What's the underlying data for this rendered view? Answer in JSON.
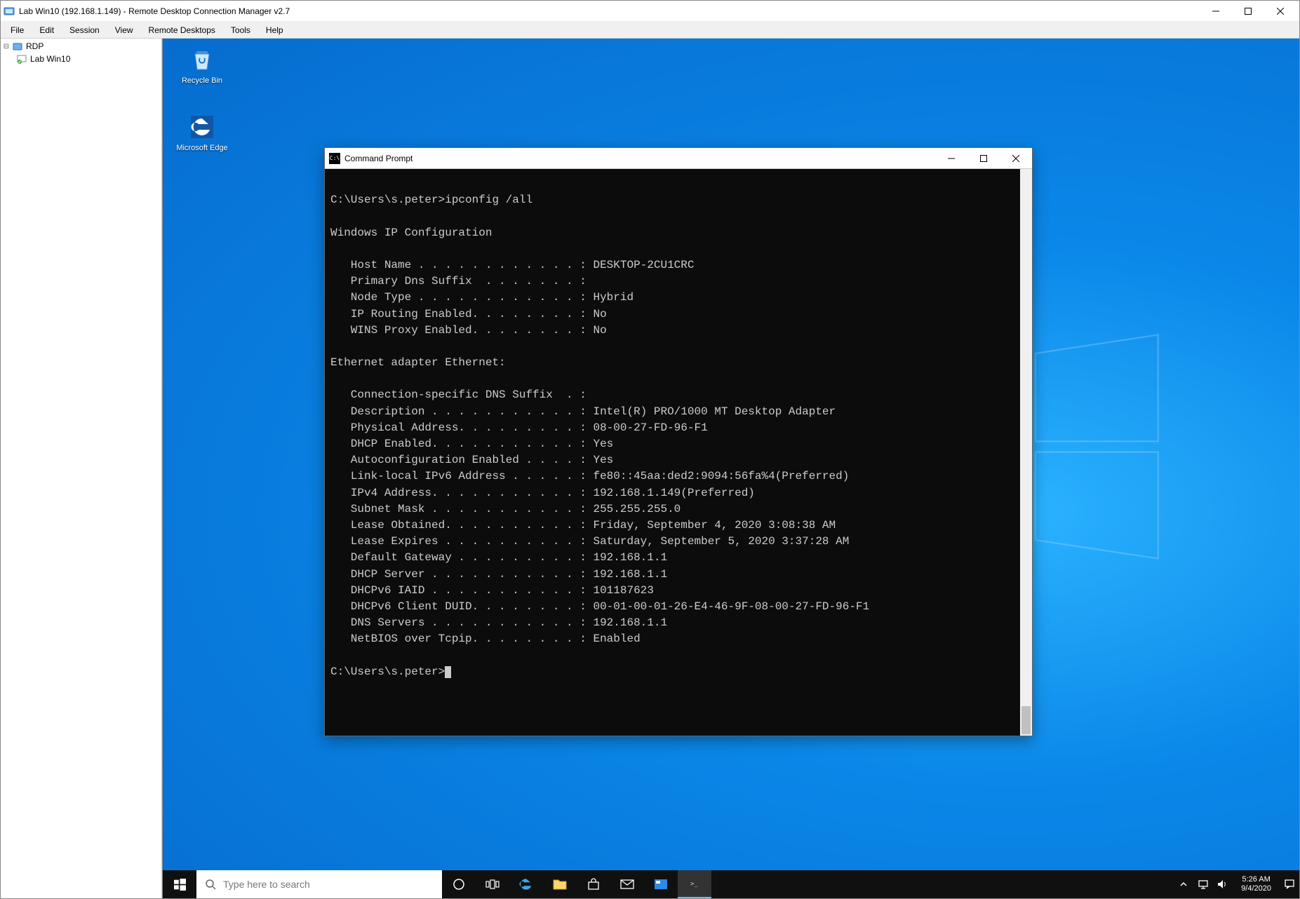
{
  "app": {
    "title": "Lab Win10 (192.168.1.149) - Remote Desktop Connection Manager v2.7",
    "menu": [
      "File",
      "Edit",
      "Session",
      "View",
      "Remote Desktops",
      "Tools",
      "Help"
    ]
  },
  "tree": {
    "root": "RDP",
    "child": "Lab Win10"
  },
  "desktop": {
    "icons": [
      {
        "name": "recycle-bin",
        "label": "Recycle Bin"
      },
      {
        "name": "edge",
        "label": "Microsoft Edge"
      }
    ]
  },
  "cmd": {
    "title": "Command Prompt",
    "prompt1": "C:\\Users\\s.peter>ipconfig /all",
    "blank": "",
    "hdr": "Windows IP Configuration",
    "cfg": {
      "host": "   Host Name . . . . . . . . . . . . : DESKTOP-2CU1CRC",
      "dns": "   Primary Dns Suffix  . . . . . . . :",
      "node": "   Node Type . . . . . . . . . . . . : Hybrid",
      "iprt": "   IP Routing Enabled. . . . . . . . : No",
      "wins": "   WINS Proxy Enabled. . . . . . . . : No"
    },
    "adapterHdr": "Ethernet adapter Ethernet:",
    "adapter": {
      "csd": "   Connection-specific DNS Suffix  . :",
      "desc": "   Description . . . . . . . . . . . : Intel(R) PRO/1000 MT Desktop Adapter",
      "phys": "   Physical Address. . . . . . . . . : 08-00-27-FD-96-F1",
      "dhcp": "   DHCP Enabled. . . . . . . . . . . : Yes",
      "auto": "   Autoconfiguration Enabled . . . . : Yes",
      "ll6": "   Link-local IPv6 Address . . . . . : fe80::45aa:ded2:9094:56fa%4(Preferred)",
      "ip4": "   IPv4 Address. . . . . . . . . . . : 192.168.1.149(Preferred)",
      "mask": "   Subnet Mask . . . . . . . . . . . : 255.255.255.0",
      "lobt": "   Lease Obtained. . . . . . . . . . : Friday, September 4, 2020 3:08:38 AM",
      "lexp": "   Lease Expires . . . . . . . . . . : Saturday, September 5, 2020 3:37:28 AM",
      "gw": "   Default Gateway . . . . . . . . . : 192.168.1.1",
      "dsrv": "   DHCP Server . . . . . . . . . . . : 192.168.1.1",
      "iaid": "   DHCPv6 IAID . . . . . . . . . . . : 101187623",
      "duid": "   DHCPv6 Client DUID. . . . . . . . : 00-01-00-01-26-E4-46-9F-08-00-27-FD-96-F1",
      "dnss": "   DNS Servers . . . . . . . . . . . : 192.168.1.1",
      "nbt": "   NetBIOS over Tcpip. . . . . . . . : Enabled"
    },
    "prompt2": "C:\\Users\\s.peter>"
  },
  "taskbar": {
    "search_placeholder": "Type here to search",
    "time": "5:26 AM",
    "date": "9/4/2020"
  }
}
